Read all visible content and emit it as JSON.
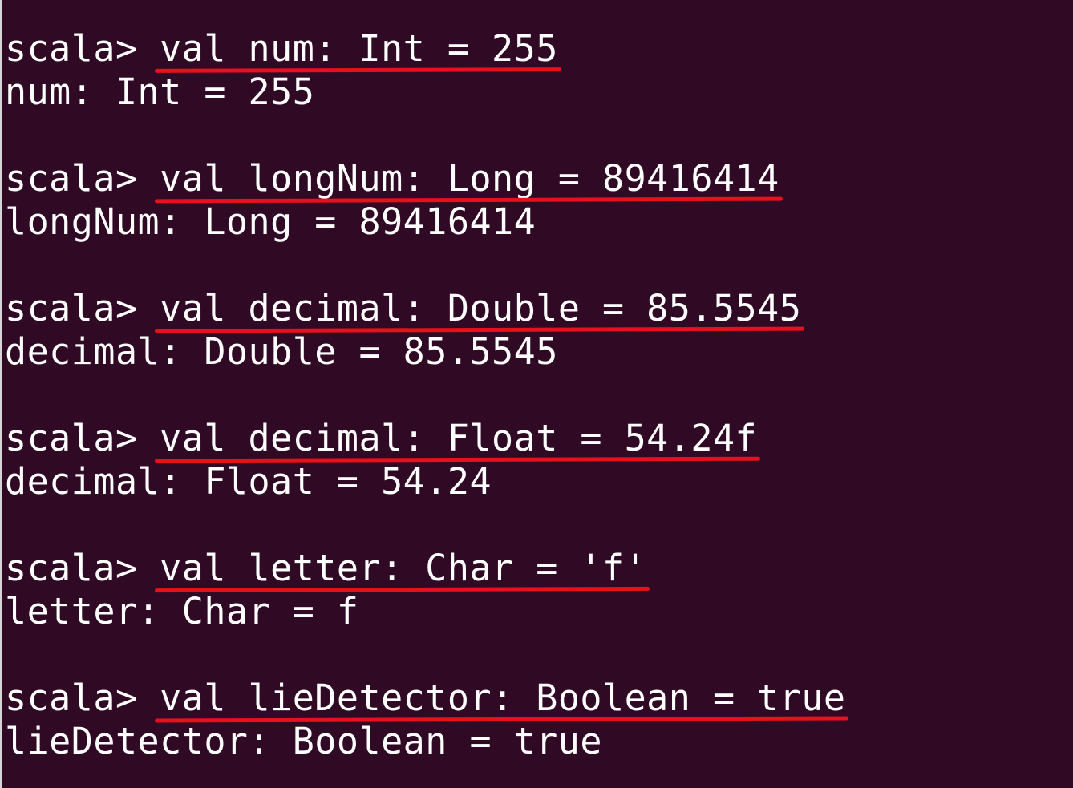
{
  "terminal": {
    "prompt": "scala> ",
    "blocks": [
      {
        "command": "val num: Int = 255",
        "output": "num: Int = 255"
      },
      {
        "command": "val longNum: Long = 89416414",
        "output": "longNum: Long = 89416414"
      },
      {
        "command": "val decimal: Double = 85.5545",
        "output": "decimal: Double = 85.5545"
      },
      {
        "command": "val decimal: Float = 54.24f",
        "output": "decimal: Float = 54.24"
      },
      {
        "command": "val letter: Char = 'f'",
        "output": "letter: Char = f"
      },
      {
        "command": "val lieDetector: Boolean = true",
        "output": "lieDetector: Boolean = true"
      }
    ]
  },
  "colors": {
    "background": "#300a24",
    "text": "#ffffff",
    "underline": "#e8101c"
  }
}
